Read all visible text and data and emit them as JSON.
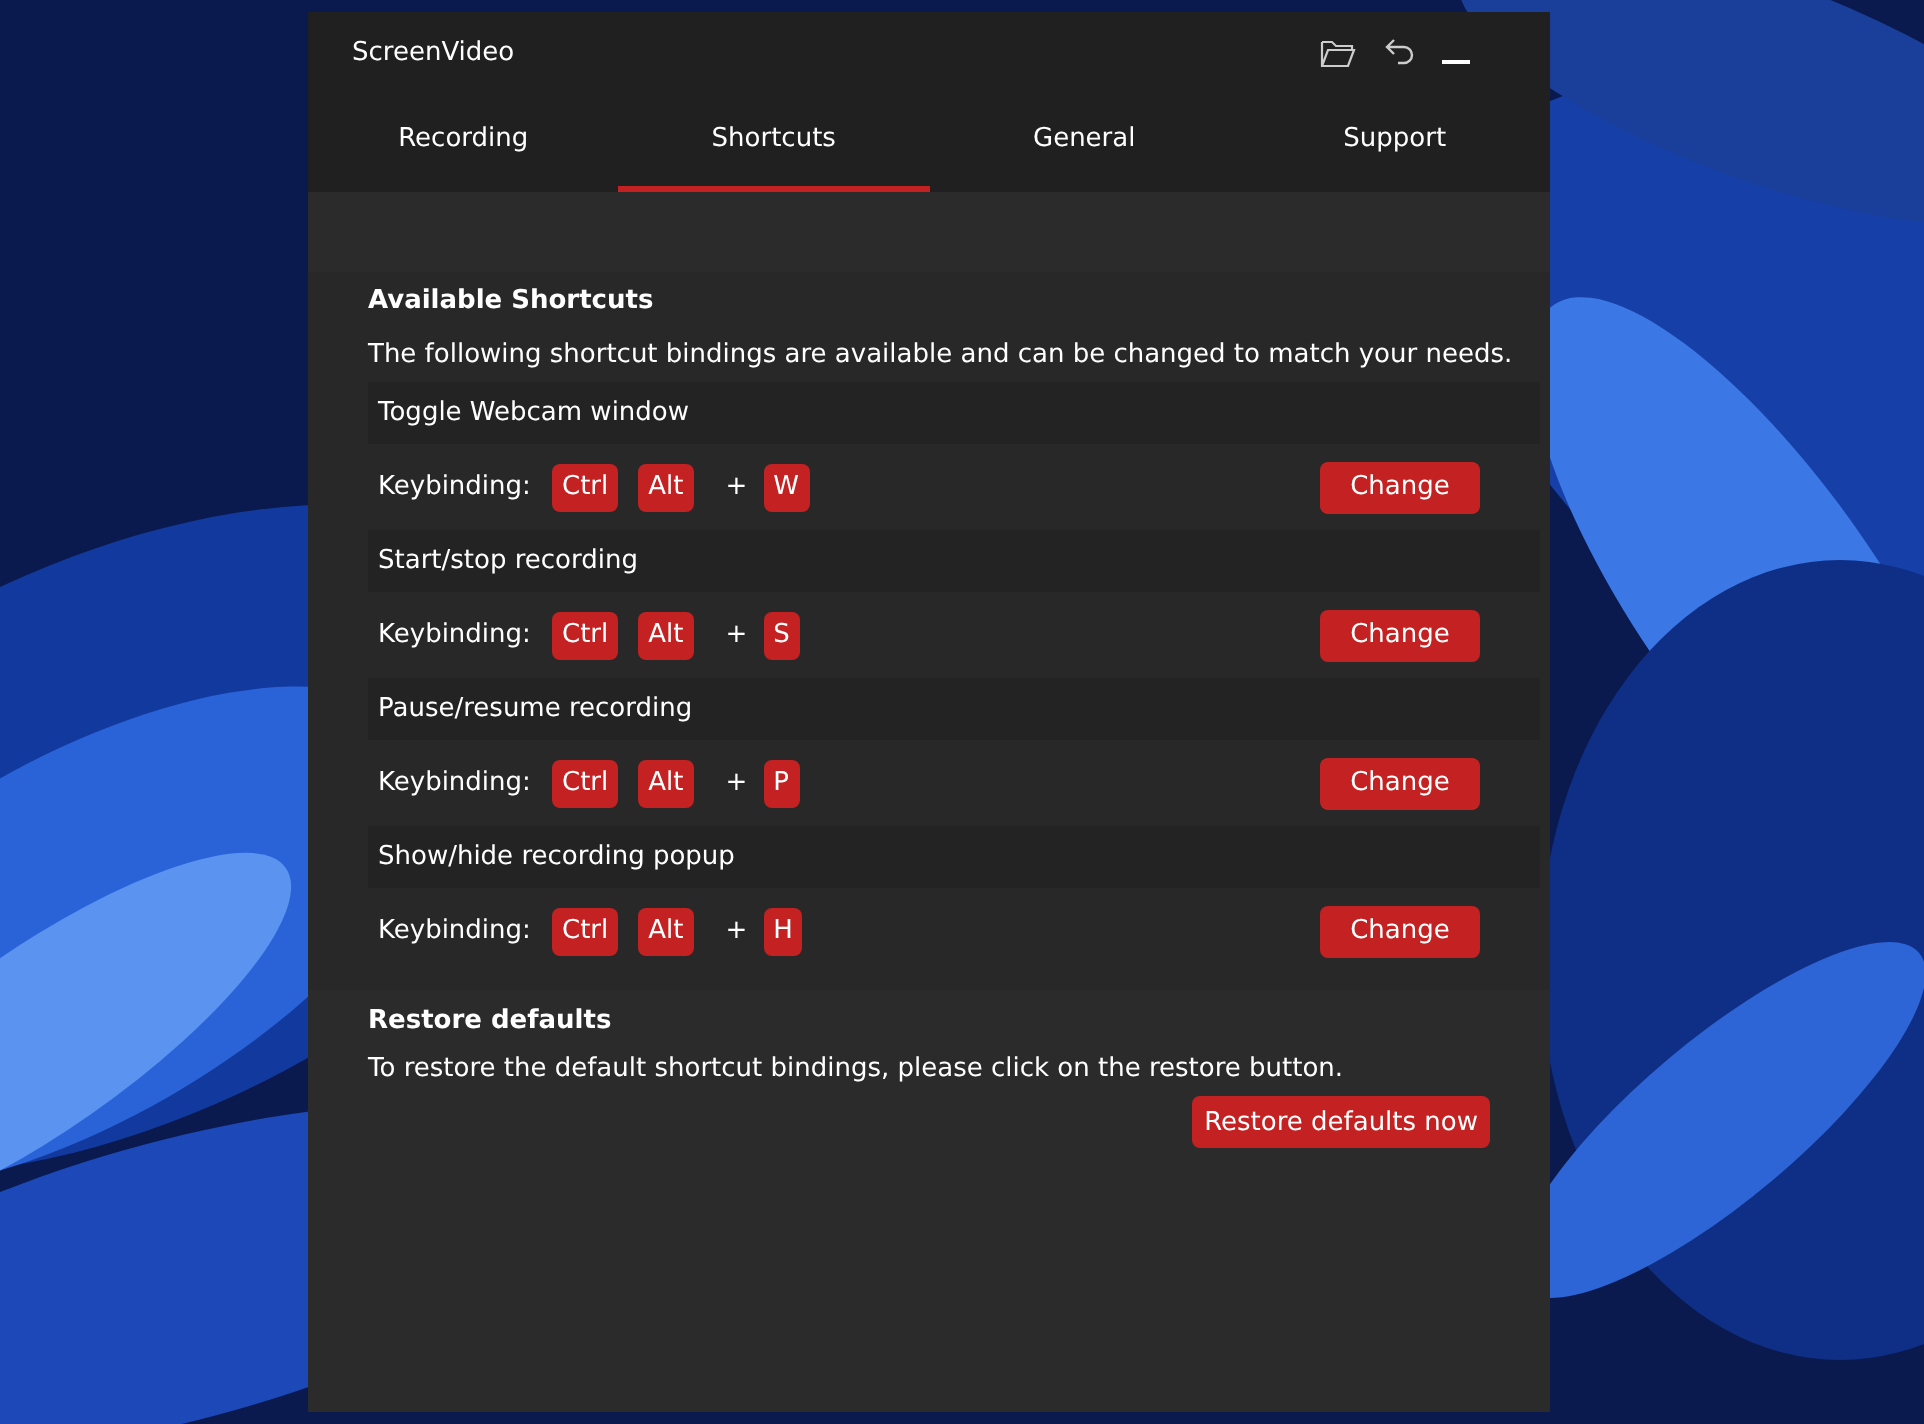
{
  "window": {
    "title": "ScreenVideo"
  },
  "tabs": [
    {
      "label": "Recording",
      "selected": false
    },
    {
      "label": "Shortcuts",
      "selected": true
    },
    {
      "label": "General",
      "selected": false
    },
    {
      "label": "Support",
      "selected": false
    }
  ],
  "available": {
    "heading": "Available Shortcuts",
    "description": "The following shortcut bindings are available and can be changed to match your needs.",
    "shortcuts": [
      {
        "name": "Toggle Webcam window",
        "label": "Keybinding:",
        "modifiers": [
          "Ctrl",
          "Alt"
        ],
        "plus": "+",
        "key": "W",
        "button": "Change"
      },
      {
        "name": "Start/stop recording",
        "label": "Keybinding:",
        "modifiers": [
          "Ctrl",
          "Alt"
        ],
        "plus": "+",
        "key": "S",
        "button": "Change"
      },
      {
        "name": "Pause/resume recording",
        "label": "Keybinding:",
        "modifiers": [
          "Ctrl",
          "Alt"
        ],
        "plus": "+",
        "key": "P",
        "button": "Change"
      },
      {
        "name": "Show/hide recording popup",
        "label": "Keybinding:",
        "modifiers": [
          "Ctrl",
          "Alt"
        ],
        "plus": "+",
        "key": "H",
        "button": "Change"
      }
    ]
  },
  "restore": {
    "heading": "Restore defaults",
    "description": "To restore the default shortcut bindings, please click on the restore button.",
    "button": "Restore defaults now"
  }
}
